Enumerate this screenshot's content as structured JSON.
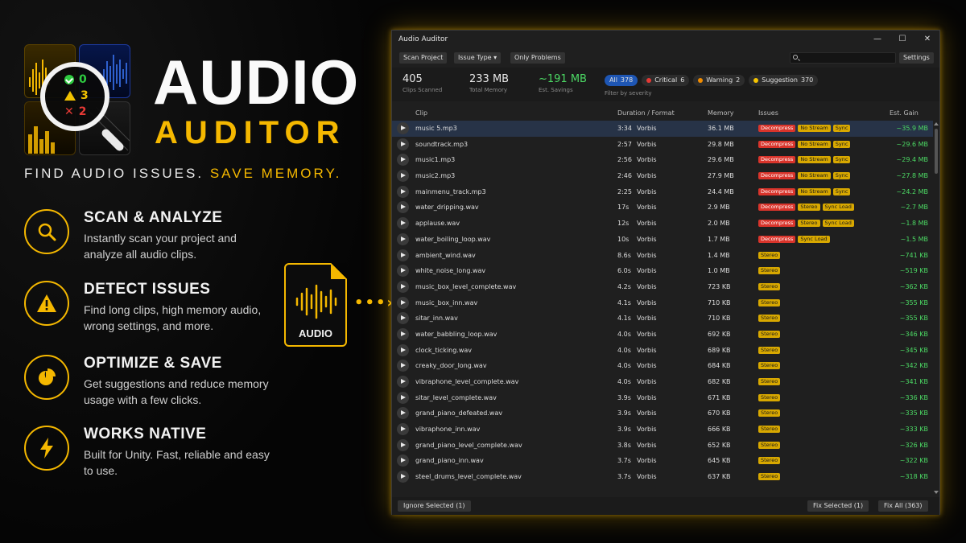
{
  "promo": {
    "logo_counts": {
      "ok": "0",
      "warn": "3",
      "error": "2"
    },
    "brand_line1": "AUDIO",
    "brand_line2": "AUDITOR",
    "tagline_a": "FIND AUDIO ISSUES.",
    "tagline_b": "SAVE MEMORY.",
    "features": [
      {
        "title": "SCAN & ANALYZE",
        "desc": "Instantly scan your project and analyze all audio clips.",
        "icon": "magnifier-icon"
      },
      {
        "title": "DETECT ISSUES",
        "desc": "Find long clips, high memory audio, wrong settings, and more.",
        "icon": "warning-icon"
      },
      {
        "title": "OPTIMIZE & SAVE",
        "desc": "Get suggestions and reduce memory usage with a few clicks.",
        "icon": "pie-chart-icon"
      },
      {
        "title": "WORKS NATIVE",
        "desc": "Built for Unity. Fast, reliable and easy to use.",
        "icon": "lightning-icon"
      }
    ],
    "file_label": "AUDIO",
    "accent": "#f5b800"
  },
  "window": {
    "title": "Audio Auditor",
    "toolbar": {
      "scan": "Scan Project",
      "issue_type": "Issue Type ▾",
      "only_problems": "Only Problems",
      "search_value": "",
      "settings": "Settings"
    },
    "stats": {
      "clips": {
        "value": "405",
        "label": "Clips Scanned"
      },
      "memory": {
        "value": "233 MB",
        "label": "Total Memory"
      },
      "savings": {
        "value": "~191 MB",
        "label": "Est. Savings"
      }
    },
    "filters": [
      {
        "label": "All",
        "count": "378",
        "color": ""
      },
      {
        "label": "Critical",
        "count": "6",
        "color": "#e53935"
      },
      {
        "label": "Warning",
        "count": "2",
        "color": "#f28c00"
      },
      {
        "label": "Suggestion",
        "count": "370",
        "color": "#f5c400"
      }
    ],
    "filter_label": "Filter by severity",
    "columns": {
      "clip": "Clip",
      "duration": "Duration / Format",
      "memory": "Memory",
      "issues": "Issues",
      "gain": "Est. Gain"
    },
    "rows": [
      {
        "clip": "music 5.mp3",
        "dur": "3:34",
        "fmt": "Vorbis",
        "mem": "36.1 MB",
        "tags": [
          [
            "Decompress",
            "red"
          ],
          [
            "No Stream",
            "yel"
          ],
          [
            "Sync",
            "yel"
          ]
        ],
        "gain": "~35.9 MB"
      },
      {
        "clip": "soundtrack.mp3",
        "dur": "2:57",
        "fmt": "Vorbis",
        "mem": "29.8 MB",
        "tags": [
          [
            "Decompress",
            "red"
          ],
          [
            "No Stream",
            "yel"
          ],
          [
            "Sync",
            "yel"
          ]
        ],
        "gain": "~29.6 MB"
      },
      {
        "clip": "music1.mp3",
        "dur": "2:56",
        "fmt": "Vorbis",
        "mem": "29.6 MB",
        "tags": [
          [
            "Decompress",
            "red"
          ],
          [
            "No Stream",
            "yel"
          ],
          [
            "Sync",
            "yel"
          ]
        ],
        "gain": "~29.4 MB"
      },
      {
        "clip": "music2.mp3",
        "dur": "2:46",
        "fmt": "Vorbis",
        "mem": "27.9 MB",
        "tags": [
          [
            "Decompress",
            "red"
          ],
          [
            "No Stream",
            "yel"
          ],
          [
            "Sync",
            "yel"
          ]
        ],
        "gain": "~27.8 MB"
      },
      {
        "clip": "mainmenu_track.mp3",
        "dur": "2:25",
        "fmt": "Vorbis",
        "mem": "24.4 MB",
        "tags": [
          [
            "Decompress",
            "red"
          ],
          [
            "No Stream",
            "yel"
          ],
          [
            "Sync",
            "yel"
          ]
        ],
        "gain": "~24.2 MB"
      },
      {
        "clip": "water_dripping.wav",
        "dur": "17s",
        "fmt": "Vorbis",
        "mem": "2.9 MB",
        "tags": [
          [
            "Decompress",
            "red"
          ],
          [
            "Stereo",
            "yel"
          ],
          [
            "Sync Load",
            "yel"
          ]
        ],
        "gain": "~2.7 MB"
      },
      {
        "clip": "applause.wav",
        "dur": "12s",
        "fmt": "Vorbis",
        "mem": "2.0 MB",
        "tags": [
          [
            "Decompress",
            "red"
          ],
          [
            "Stereo",
            "yel"
          ],
          [
            "Sync Load",
            "yel"
          ]
        ],
        "gain": "~1.8 MB"
      },
      {
        "clip": "water_boiling_loop.wav",
        "dur": "10s",
        "fmt": "Vorbis",
        "mem": "1.7 MB",
        "tags": [
          [
            "Decompress",
            "red"
          ],
          [
            "Sync Load",
            "yel"
          ]
        ],
        "gain": "~1.5 MB"
      },
      {
        "clip": "ambient_wind.wav",
        "dur": "8.6s",
        "fmt": "Vorbis",
        "mem": "1.4 MB",
        "tags": [
          [
            "Stereo",
            "yel"
          ]
        ],
        "gain": "~741 KB"
      },
      {
        "clip": "white_noise_long.wav",
        "dur": "6.0s",
        "fmt": "Vorbis",
        "mem": "1.0 MB",
        "tags": [
          [
            "Stereo",
            "yel"
          ]
        ],
        "gain": "~519 KB"
      },
      {
        "clip": "music_box_level_complete.wav",
        "dur": "4.2s",
        "fmt": "Vorbis",
        "mem": "723 KB",
        "tags": [
          [
            "Stereo",
            "yel"
          ]
        ],
        "gain": "~362 KB"
      },
      {
        "clip": "music_box_inn.wav",
        "dur": "4.1s",
        "fmt": "Vorbis",
        "mem": "710 KB",
        "tags": [
          [
            "Stereo",
            "yel"
          ]
        ],
        "gain": "~355 KB"
      },
      {
        "clip": "sitar_inn.wav",
        "dur": "4.1s",
        "fmt": "Vorbis",
        "mem": "710 KB",
        "tags": [
          [
            "Stereo",
            "yel"
          ]
        ],
        "gain": "~355 KB"
      },
      {
        "clip": "water_babbling_loop.wav",
        "dur": "4.0s",
        "fmt": "Vorbis",
        "mem": "692 KB",
        "tags": [
          [
            "Stereo",
            "yel"
          ]
        ],
        "gain": "~346 KB"
      },
      {
        "clip": "clock_ticking.wav",
        "dur": "4.0s",
        "fmt": "Vorbis",
        "mem": "689 KB",
        "tags": [
          [
            "Stereo",
            "yel"
          ]
        ],
        "gain": "~345 KB"
      },
      {
        "clip": "creaky_door_long.wav",
        "dur": "4.0s",
        "fmt": "Vorbis",
        "mem": "684 KB",
        "tags": [
          [
            "Stereo",
            "yel"
          ]
        ],
        "gain": "~342 KB"
      },
      {
        "clip": "vibraphone_level_complete.wav",
        "dur": "4.0s",
        "fmt": "Vorbis",
        "mem": "682 KB",
        "tags": [
          [
            "Stereo",
            "yel"
          ]
        ],
        "gain": "~341 KB"
      },
      {
        "clip": "sitar_level_complete.wav",
        "dur": "3.9s",
        "fmt": "Vorbis",
        "mem": "671 KB",
        "tags": [
          [
            "Stereo",
            "yel"
          ]
        ],
        "gain": "~336 KB"
      },
      {
        "clip": "grand_piano_defeated.wav",
        "dur": "3.9s",
        "fmt": "Vorbis",
        "mem": "670 KB",
        "tags": [
          [
            "Stereo",
            "yel"
          ]
        ],
        "gain": "~335 KB"
      },
      {
        "clip": "vibraphone_inn.wav",
        "dur": "3.9s",
        "fmt": "Vorbis",
        "mem": "666 KB",
        "tags": [
          [
            "Stereo",
            "yel"
          ]
        ],
        "gain": "~333 KB"
      },
      {
        "clip": "grand_piano_level_complete.wav",
        "dur": "3.8s",
        "fmt": "Vorbis",
        "mem": "652 KB",
        "tags": [
          [
            "Stereo",
            "yel"
          ]
        ],
        "gain": "~326 KB"
      },
      {
        "clip": "grand_piano_inn.wav",
        "dur": "3.7s",
        "fmt": "Vorbis",
        "mem": "645 KB",
        "tags": [
          [
            "Stereo",
            "yel"
          ]
        ],
        "gain": "~322 KB"
      },
      {
        "clip": "steel_drums_level_complete.wav",
        "dur": "3.7s",
        "fmt": "Vorbis",
        "mem": "637 KB",
        "tags": [
          [
            "Stereo",
            "yel"
          ]
        ],
        "gain": "~318 KB"
      }
    ],
    "footer": {
      "ignore": "Ignore Selected (1)",
      "fix_selected": "Fix Selected (1)",
      "fix_all": "Fix All (363)"
    },
    "savings_color": "#4cd964"
  }
}
